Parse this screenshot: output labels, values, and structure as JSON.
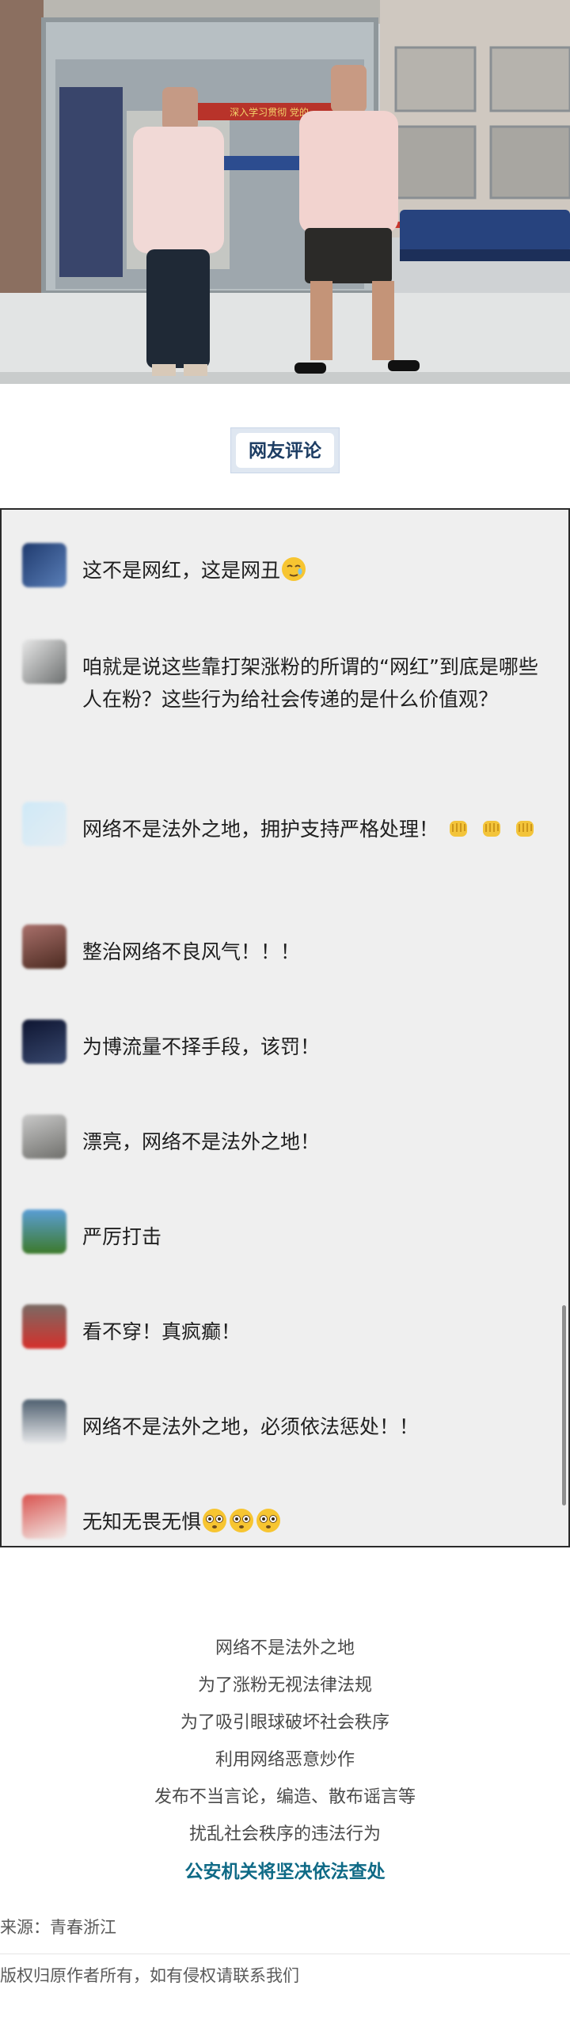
{
  "section_title": "网友评论",
  "comments": [
    {
      "text": "这不是网红，这是网丑",
      "emoji": [
        "sleepy-face-icon"
      ]
    },
    {
      "text": "咱就是说这些靠打架涨粉的所谓的“网红”到底是哪些人在粉？这些行为给社会传递的是什么价值观？",
      "emoji": []
    },
    {
      "text": "网络不是法外之地，拥护支持严格处理！",
      "emoji": [
        "fist-icon",
        "fist-icon",
        "fist-icon"
      ]
    },
    {
      "text": "整治网络不良风气！！！",
      "emoji": []
    },
    {
      "text": "为博流量不择手段，该罚！",
      "emoji": []
    },
    {
      "text": "漂亮，网络不是法外之地！",
      "emoji": []
    },
    {
      "text": "严厉打击",
      "emoji": []
    },
    {
      "text": "看不穿！真疯癫！",
      "emoji": []
    },
    {
      "text": "网络不是法外之地，必须依法惩处！！",
      "emoji": []
    },
    {
      "text": "无知无畏无惧",
      "emoji": [
        "flushed-face-icon",
        "flushed-face-icon",
        "flushed-face-icon"
      ]
    }
  ],
  "statements": [
    "网络不是法外之地",
    "为了涨粉无视法律法规",
    "为了吸引眼球破坏社会秩序",
    "利用网络恶意炒作",
    "发布不当言论，编造、散布谣言等",
    "扰乱社会秩序的违法行为"
  ],
  "statement_emphasis": "公安机关将坚决依法查处",
  "photo_banner": "深入学习贯彻 党的",
  "source": "来源：青春浙江",
  "copyright": "版权归原作者所有，如有侵权请联系我们",
  "colors": {
    "accent": "#0f6a86",
    "title_bg": "#dfe7f1",
    "panel_bg": "#efefef"
  }
}
